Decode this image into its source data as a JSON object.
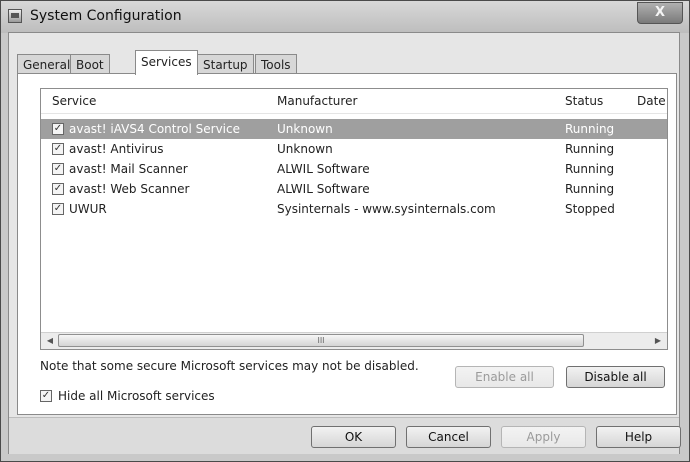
{
  "window": {
    "title": "System Configuration",
    "close_label": "X"
  },
  "tabs": [
    {
      "label": "General"
    },
    {
      "label": "Boot"
    },
    {
      "label": "Services",
      "active": true
    },
    {
      "label": "Startup"
    },
    {
      "label": "Tools"
    }
  ],
  "columns": [
    "Service",
    "Manufacturer",
    "Status",
    "Date"
  ],
  "services": [
    {
      "checked": true,
      "name": "avast! iAVS4 Control Service",
      "manufacturer": "Unknown",
      "status": "Running",
      "selected": true
    },
    {
      "checked": true,
      "name": "avast! Antivirus",
      "manufacturer": "Unknown",
      "status": "Running"
    },
    {
      "checked": true,
      "name": "avast! Mail Scanner",
      "manufacturer": "ALWIL Software",
      "status": "Running"
    },
    {
      "checked": true,
      "name": "avast! Web Scanner",
      "manufacturer": "ALWIL Software",
      "status": "Running"
    },
    {
      "checked": true,
      "name": "UWUR",
      "manufacturer": "Sysinternals - www.sysinternals.com",
      "status": "Stopped"
    }
  ],
  "scrollbar": {
    "left_arrow": "◀",
    "right_arrow": "▶",
    "thumb_grip": "III"
  },
  "note": "Note that some secure Microsoft services may not be disabled.",
  "buttons": {
    "enable_all": "Enable all",
    "disable_all": "Disable all",
    "ok": "OK",
    "cancel": "Cancel",
    "apply": "Apply",
    "help": "Help"
  },
  "hide_ms": {
    "checked": true,
    "label": "Hide all Microsoft services"
  },
  "icons": {
    "window": "msconfig-icon",
    "checkmark": "✓"
  },
  "colors": {
    "selection": "#9f9f9f",
    "window_bg": "#e6e6e6"
  }
}
